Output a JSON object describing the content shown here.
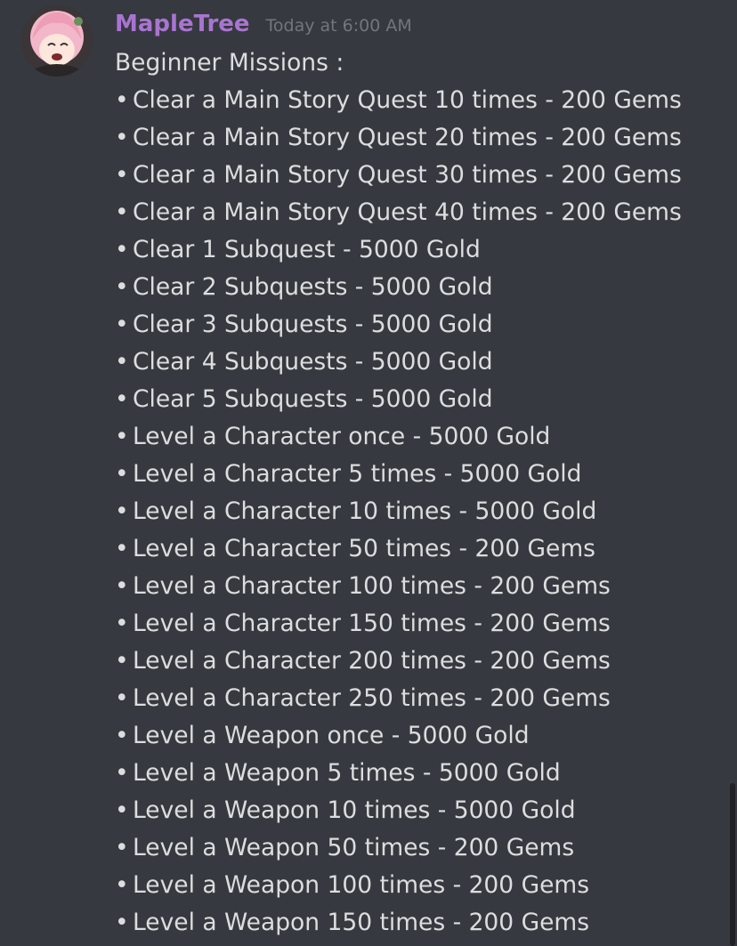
{
  "message": {
    "author": "MapleTree",
    "author_color": "#a974d1",
    "timestamp": "Today at 6:00 AM",
    "avatar_icon": "anime-girl-avatar-icon",
    "heading": "Beginner Missions :",
    "bullet": "•",
    "items": [
      "Clear a Main Story Quest 10 times - 200 Gems",
      "Clear a Main Story Quest 20 times - 200 Gems",
      "Clear a Main Story Quest 30 times - 200 Gems",
      "Clear a Main Story Quest 40 times - 200 Gems",
      "Clear 1 Subquest - 5000 Gold",
      "Clear 2 Subquests - 5000 Gold",
      "Clear 3 Subquests - 5000 Gold",
      "Clear 4 Subquests - 5000 Gold",
      "Clear 5 Subquests - 5000 Gold",
      "Level a Character once - 5000 Gold",
      "Level a Character 5 times - 5000 Gold",
      "Level a Character 10 times - 5000 Gold",
      "Level a Character 50 times - 200 Gems",
      "Level a Character 100 times - 200 Gems",
      "Level a Character 150 times - 200 Gems",
      "Level a Character 200 times - 200 Gems",
      "Level a Character 250 times - 200 Gems",
      "Level a Weapon once - 5000 Gold",
      "Level a Weapon 5 times - 5000 Gold",
      "Level a Weapon 10 times - 5000 Gold",
      "Level a Weapon 50 times - 200 Gems",
      "Level a Weapon 100 times - 200 Gems",
      "Level a Weapon 150 times - 200 Gems"
    ]
  }
}
